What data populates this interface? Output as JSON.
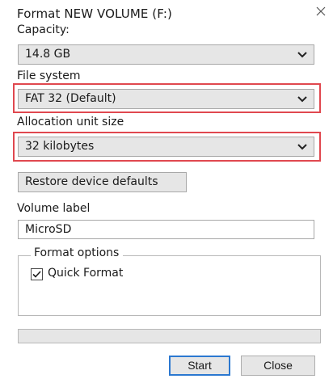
{
  "window": {
    "title": "Format NEW VOLUME (F:)",
    "close_icon": "close-icon"
  },
  "capacity": {
    "label": "Capacity:",
    "value": "14.8 GB"
  },
  "file_system": {
    "label": "File system",
    "value": "FAT 32 (Default)"
  },
  "allocation": {
    "label": "Allocation unit size",
    "value": "32 kilobytes"
  },
  "restore_button": "Restore device defaults",
  "volume_label": {
    "label": "Volume label",
    "value": "MicroSD"
  },
  "format_options": {
    "legend": "Format options",
    "quick_format": {
      "label": "Quick Format",
      "checked": true
    }
  },
  "progress": {
    "fraction": 0
  },
  "buttons": {
    "start": "Start",
    "close": "Close"
  },
  "colors": {
    "highlight": "#e0484f",
    "default_button_border": "#2b78d0",
    "control_fill": "#e6e6e6"
  }
}
